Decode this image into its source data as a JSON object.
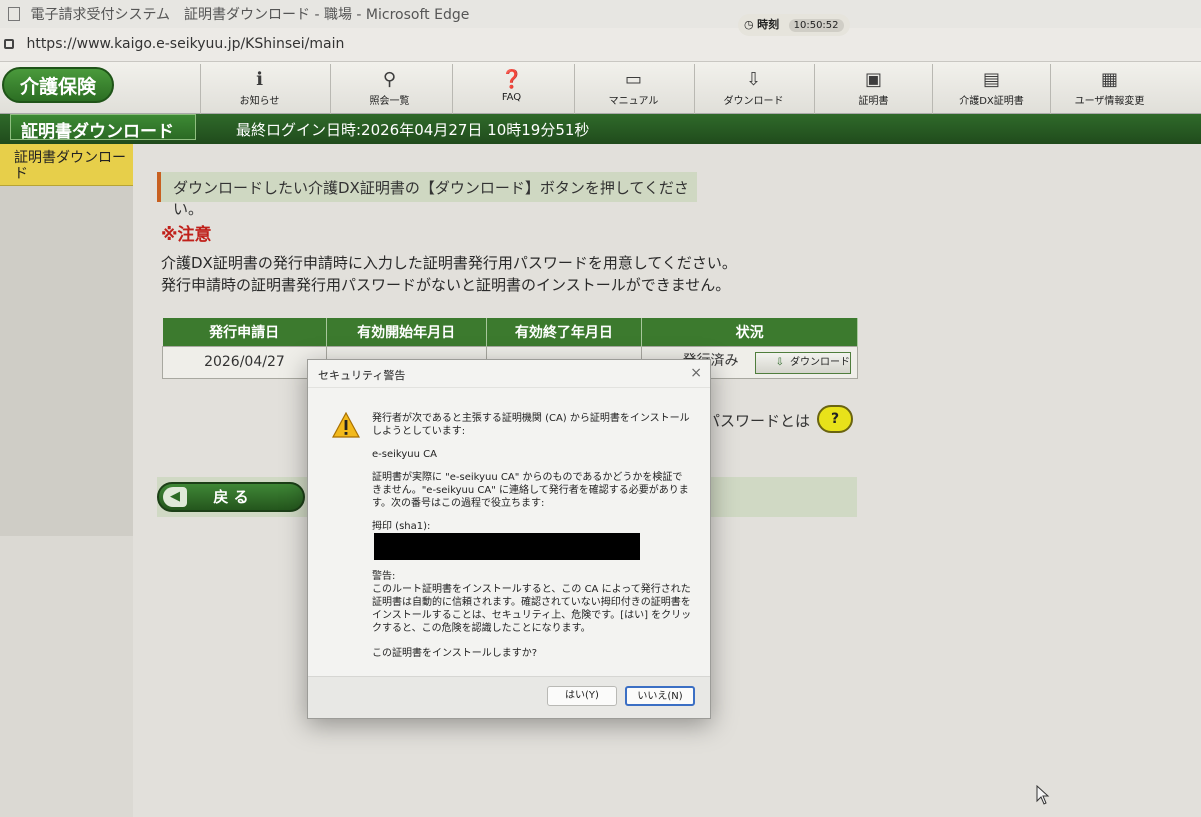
{
  "window": {
    "title": "電子請求受付システム　証明書ダウンロード - 職場 - Microsoft Edge",
    "url": "https://www.kaigo.e-seikyuu.jp/KShinsei/main"
  },
  "nav": {
    "brand": "介護保険",
    "items": [
      {
        "label": "お知らせ",
        "icon": "info-icon"
      },
      {
        "label": "照会一覧",
        "icon": "magnifier-icon"
      },
      {
        "label": "FAQ",
        "icon": "faq-icon"
      },
      {
        "label": "マニュアル",
        "icon": "book-icon"
      },
      {
        "label": "ダウンロード",
        "icon": "download-icon"
      },
      {
        "label": "証明書",
        "icon": "certificate-icon"
      },
      {
        "label": "介護DX証明書",
        "icon": "dx-certificate-icon"
      },
      {
        "label": "ユーザ情報変更",
        "icon": "user-card-icon"
      }
    ]
  },
  "header": {
    "page_title": "証明書ダウンロード",
    "last_login": "最終ログイン日時:2026年04月27日 10時19分51秒",
    "clock_label": "時刻",
    "clock_time": "10:50:52"
  },
  "sidebar": {
    "items": [
      {
        "label": "証明書ダウンロード"
      }
    ]
  },
  "main": {
    "instruction": "ダウンロードしたい介護DX証明書の【ダウンロード】ボタンを押してください。",
    "warning_heading": "※注意",
    "warning_lines": [
      "介護DX証明書の発行申請時に入力した証明書発行用パスワードを用意してください。",
      "発行申請時の証明書発行用パスワードがないと証明書のインストールができません。"
    ],
    "table": {
      "headers": [
        "発行申請日",
        "有効開始年月日",
        "有効終了年月日",
        "状況"
      ],
      "rows": [
        {
          "issue_date": "2026/04/27",
          "start": "",
          "end": "",
          "status": "発行済み",
          "action": "ダウンロード"
        }
      ]
    },
    "password_help": "パスワードとは",
    "help_label": "?",
    "back_label": "戻 る"
  },
  "dialog": {
    "title": "セキュリティ警告",
    "close": "×",
    "para1": "発行者が次であると主張する証明機関 (CA) から証明書をインストールしようとしています:",
    "ca_name": "e-seikyuu CA",
    "para2": "証明書が実際に \"e-seikyuu CA\" からのものであるかどうかを検証できません。\"e-seikyuu CA\" に連絡して発行者を確認する必要があります。次の番号はこの過程で役立ちます:",
    "thumb_label": "拇印 (sha1):",
    "warning_label": "警告:",
    "warning_text": "このルート証明書をインストールすると、この CA によって発行された証明書は自動的に信頼されます。確認されていない拇印付きの証明書をインストールすることは、セキュリティ上、危険です。[はい] をクリックすると、この危険を認識したことになります。",
    "question": "この証明書をインストールしますか?",
    "yes_label": "はい(Y)",
    "no_label": "いいえ(N)"
  }
}
